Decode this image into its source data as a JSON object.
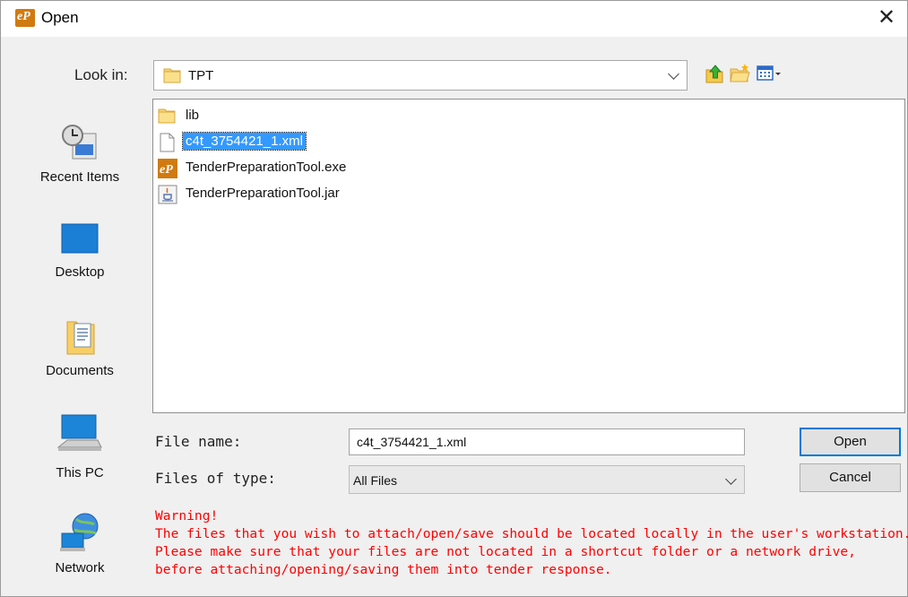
{
  "window": {
    "title": "Open",
    "app_icon_text": "eP",
    "close_glyph": "✕"
  },
  "lookin": {
    "label": "Look in:",
    "value": "TPT"
  },
  "toolbar": {
    "icons": [
      "up-folder-icon",
      "new-folder-icon",
      "view-menu-icon"
    ]
  },
  "places": [
    {
      "label": "Recent Items",
      "icon": "recent-items-icon"
    },
    {
      "label": "Desktop",
      "icon": "desktop-icon"
    },
    {
      "label": "Documents",
      "icon": "documents-icon"
    },
    {
      "label": "This PC",
      "icon": "this-pc-icon"
    },
    {
      "label": "Network",
      "icon": "network-icon"
    }
  ],
  "files": [
    {
      "name": "lib",
      "icon": "folder-icon",
      "selected": false
    },
    {
      "name": "c4t_3754421_1.xml",
      "icon": "xml-file-icon",
      "selected": true
    },
    {
      "name": "TenderPreparationTool.exe",
      "icon": "exe-app-icon",
      "selected": false
    },
    {
      "name": "TenderPreparationTool.jar",
      "icon": "jar-file-icon",
      "selected": false
    }
  ],
  "form": {
    "file_name_label": "File name:",
    "file_name_value": "c4t_3754421_1.xml",
    "file_type_label": "Files of type:",
    "file_type_value": "All Files"
  },
  "buttons": {
    "open": "Open",
    "cancel": "Cancel"
  },
  "warning": {
    "title": "Warning!",
    "line1": "The files that you wish to attach/open/save should be located locally in the user's workstation.",
    "line2": "Please make sure that your files are not located in a shortcut folder or a network drive,",
    "line3": "before attaching/opening/saving them into tender response."
  },
  "colors": {
    "selection": "#3399ff",
    "warning": "#ff0000",
    "default_button_border": "#0078d7"
  }
}
